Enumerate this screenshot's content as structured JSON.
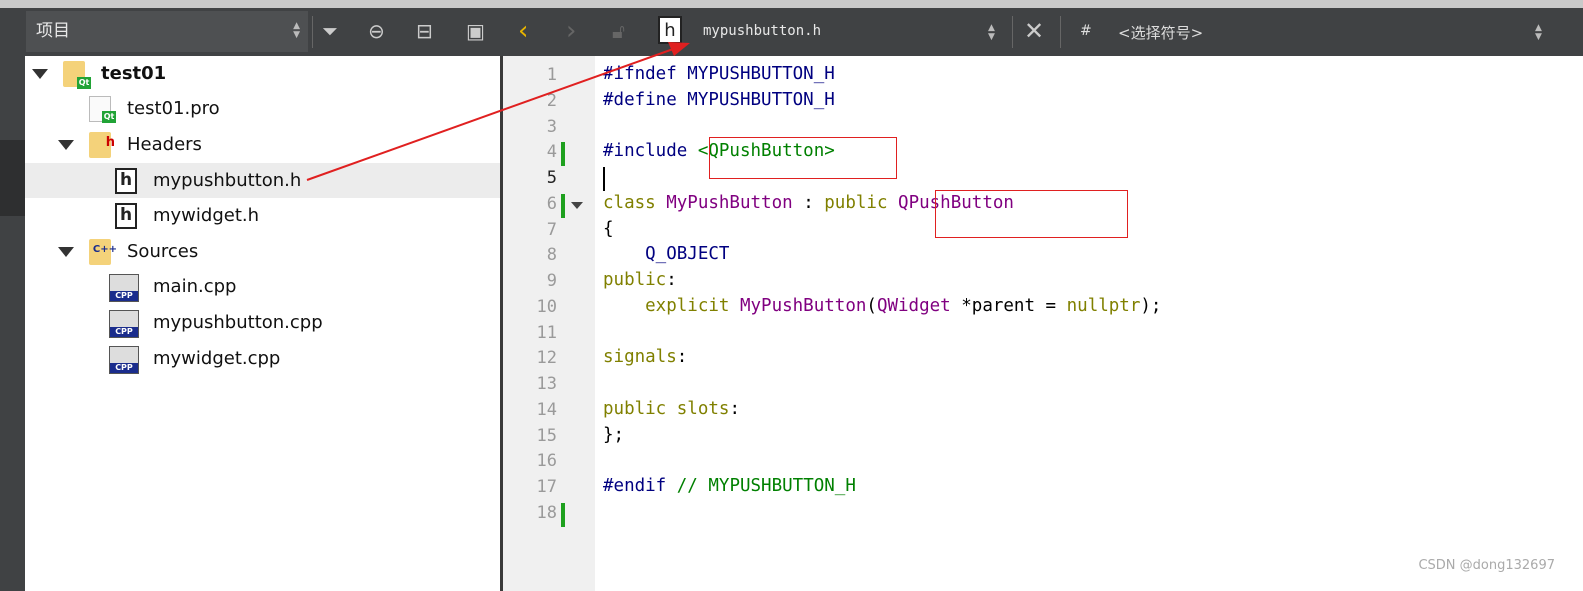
{
  "toolbar": {
    "project_selector": "项目",
    "file_selector": "mypushbutton.h",
    "symbol_hash": "#",
    "symbol_selector": "<选择符号>"
  },
  "tree": {
    "root": "test01",
    "items": [
      {
        "label": "test01.pro",
        "icon": "qt-pro-file-icon"
      },
      {
        "label": "Headers",
        "icon": "headers-folder-icon"
      },
      {
        "label": "mypushbutton.h",
        "icon": "header-file-icon",
        "selected": true
      },
      {
        "label": "mywidget.h",
        "icon": "header-file-icon"
      },
      {
        "label": "Sources",
        "icon": "sources-folder-icon"
      },
      {
        "label": "main.cpp",
        "icon": "cpp-file-icon"
      },
      {
        "label": "mypushbutton.cpp",
        "icon": "cpp-file-icon"
      },
      {
        "label": "mywidget.cpp",
        "icon": "cpp-file-icon"
      }
    ]
  },
  "editor": {
    "line_numbers": [
      "1",
      "2",
      "3",
      "4",
      "5",
      "6",
      "7",
      "8",
      "9",
      "10",
      "11",
      "12",
      "13",
      "14",
      "15",
      "16",
      "17",
      "18"
    ],
    "current_line": 5,
    "lines": [
      [
        [
          "#ifndef MYPUSHBUTTON_H",
          "pp"
        ]
      ],
      [
        [
          "#define MYPUSHBUTTON_H",
          "pp"
        ]
      ],
      [],
      [
        [
          "#include ",
          "pp"
        ],
        [
          "<QPushButton>",
          "str"
        ]
      ],
      [],
      [
        [
          "class ",
          "kw"
        ],
        [
          "MyPushButton",
          "cls"
        ],
        [
          " : ",
          "tx"
        ],
        [
          "public ",
          "kw"
        ],
        [
          "QPushButton",
          "cls"
        ]
      ],
      [
        [
          "{",
          "tx"
        ]
      ],
      [
        [
          "    Q_OBJECT",
          "mac"
        ]
      ],
      [
        [
          "public",
          "kw"
        ],
        [
          ":",
          "tx"
        ]
      ],
      [
        [
          "    explicit ",
          "kw"
        ],
        [
          "MyPushButton",
          "cls"
        ],
        [
          "(",
          "tx"
        ],
        [
          "QWidget",
          "cls"
        ],
        [
          " *parent = ",
          "tx"
        ],
        [
          "nullptr",
          "kw"
        ],
        [
          ");",
          "tx"
        ]
      ],
      [],
      [
        [
          "signals",
          "kw"
        ],
        [
          ":",
          "tx"
        ]
      ],
      [],
      [
        [
          "public slots",
          "kw"
        ],
        [
          ":",
          "tx"
        ]
      ],
      [
        [
          "};",
          "tx"
        ]
      ],
      [],
      [
        [
          "#endif ",
          "pp"
        ],
        [
          "// MYPUSHBUTTON_H",
          "cm"
        ]
      ],
      []
    ]
  },
  "watermark": "CSDN @dong132697",
  "colors": {
    "annotation": "#e02020",
    "keyword": "#808000",
    "preprocessor": "#000080",
    "class": "#800080",
    "string": "#008000"
  }
}
